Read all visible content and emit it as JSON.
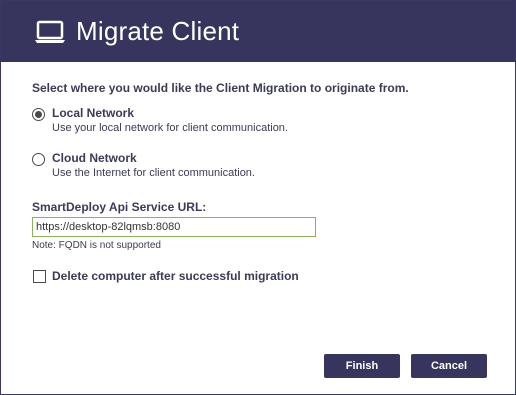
{
  "header": {
    "title": "Migrate Client",
    "icon": "laptop-icon"
  },
  "prompt": "Select where you would like the Client Migration to originate from.",
  "options": [
    {
      "title": "Local Network",
      "description": "Use your local network for client communication.",
      "selected": true
    },
    {
      "title": "Cloud Network",
      "description": "Use the Internet for client communication.",
      "selected": false
    }
  ],
  "url": {
    "label": "SmartDeploy Api Service URL:",
    "value": "https://desktop-82lqmsb:8080",
    "note": "Note: FQDN is not supported"
  },
  "delete_option": {
    "label": "Delete computer after successful migration",
    "checked": false
  },
  "buttons": {
    "finish": "Finish",
    "cancel": "Cancel"
  },
  "colors": {
    "header_bg": "#37345e",
    "button_bg": "#37345e",
    "input_border": "#8ab35e"
  }
}
